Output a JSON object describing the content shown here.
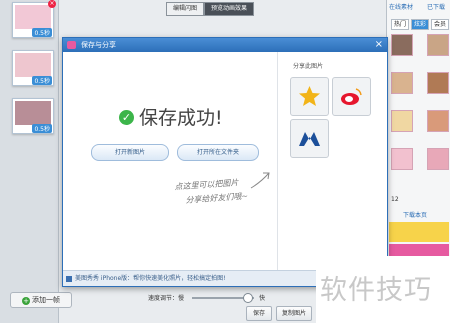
{
  "top_tabs": [
    "编辑闪图",
    "预览动画效果"
  ],
  "left_strip": {
    "thumbnails": [
      {
        "tag": "0.5秒",
        "color": "#f2c8d6"
      },
      {
        "tag": "0.5秒",
        "color": "#eec6cf"
      },
      {
        "tag": "0.5秒",
        "color": "#b88e97"
      }
    ],
    "add_frame_label": "添加一帧"
  },
  "right_panel": {
    "tabs": [
      "在线素材",
      "已下载"
    ],
    "sub_tabs": [
      "热门",
      "炫彩",
      "会员"
    ],
    "page_number": "12",
    "download_label": "下载本页",
    "accent_color": "#e65aa0"
  },
  "dialog": {
    "title": "保存与分享",
    "success_text": "保存成功!",
    "open_image_button": "打开新图片",
    "open_folder_button": "打开所在文件夹",
    "handwriting_line1": "点这里可以把图片",
    "handwriting_line2": "分享给好友们哦~",
    "share_label": "分享此图片",
    "share_icons": [
      "qzone-star-icon",
      "weibo-icon",
      "pengyou-icon"
    ],
    "footer_text": "美图秀秀 iPhone版：帮你快速美化照片，轻松搞定拍图!"
  },
  "bottom": {
    "speed_label": "速度调节：慢",
    "speed_fast": "快",
    "save_button": "保存",
    "copy_button": "复制图片"
  },
  "watermark": "软件技巧"
}
